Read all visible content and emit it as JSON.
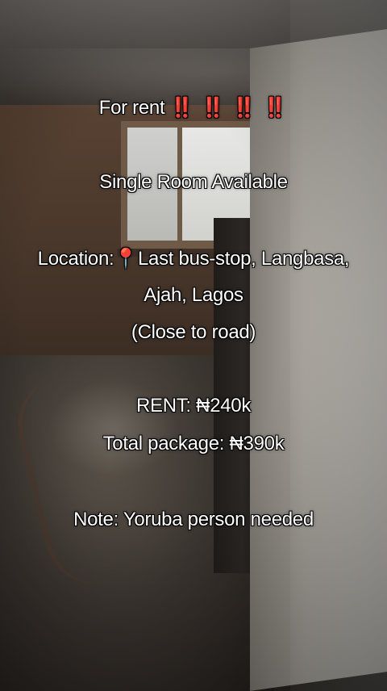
{
  "overlay": {
    "line1_text": "For rent",
    "line1_emphasis": "‼️ ‼️ ‼️ ‼️",
    "line2": "Single Room Available",
    "location_label": "Location:",
    "location_pin": "📍",
    "location_value": "Last bus-stop, Langbasa,",
    "location_value_2": "Ajah, Lagos",
    "location_note": "(Close to road)",
    "rent": "RENT: ₦240k",
    "total_package": "Total package: ₦390k",
    "note": "Note: Yoruba person needed"
  },
  "colors": {
    "text": "#ffffff",
    "emphasis": "#e4202a"
  }
}
